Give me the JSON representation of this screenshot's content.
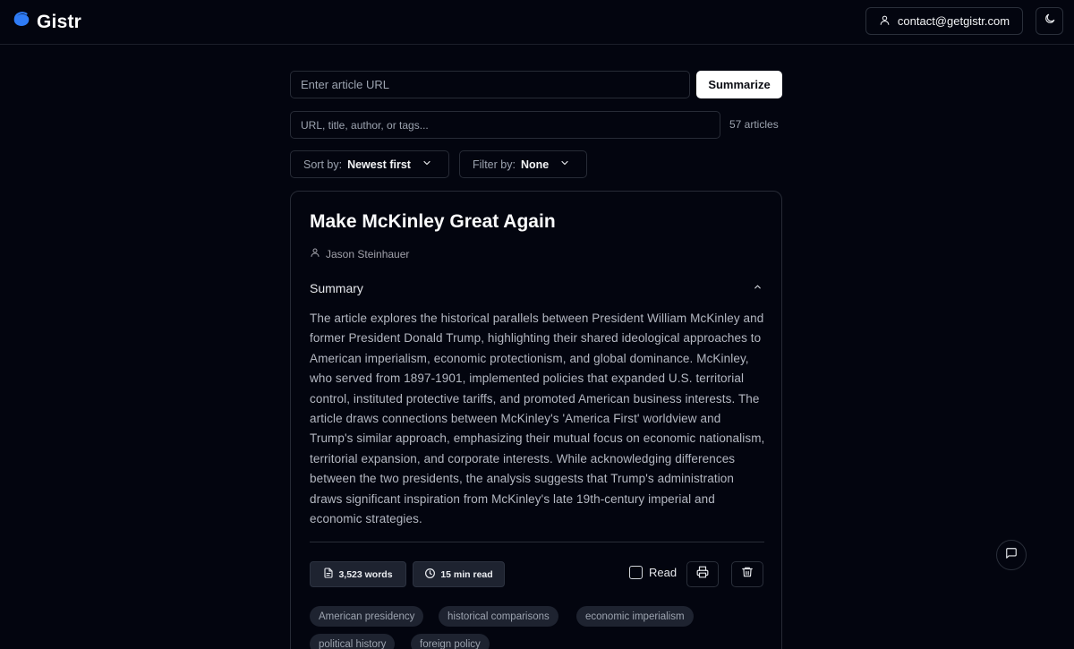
{
  "app": {
    "name": "Gistr",
    "contact_email": "contact@getgistr.com",
    "accent_color": "#2563eb"
  },
  "summarize_form": {
    "url_placeholder": "Enter article URL",
    "submit_label": "Summarize"
  },
  "search": {
    "placeholder": "URL, title, author, or tags...",
    "count_label": "57 articles"
  },
  "sort": {
    "label": "Sort by:",
    "value": "Newest first"
  },
  "filter": {
    "label": "Filter by:",
    "value": "None"
  },
  "article": {
    "title": "Make McKinley Great Again",
    "author": "Jason Steinhauer",
    "summary_heading": "Summary",
    "summary": "The article explores the historical parallels between President William McKinley and former President Donald Trump, highlighting their shared ideological approaches to American imperialism, economic protectionism, and global dominance. McKinley, who served from 1897-1901, implemented policies that expanded U.S. territorial control, instituted protective tariffs, and promoted American business interests. The article draws connections between McKinley's 'America First' worldview and Trump's similar approach, emphasizing their mutual focus on economic nationalism, territorial expansion, and corporate interests. While acknowledging differences between the two presidents, the analysis suggests that Trump's administration draws significant inspiration from McKinley's late 19th-century imperial and economic strategies.",
    "word_count": "3,523 words",
    "read_time": "15 min read",
    "read_label": "Read",
    "tags": [
      "American presidency",
      "historical comparisons",
      "economic imperialism",
      "political history",
      "foreign policy"
    ]
  }
}
